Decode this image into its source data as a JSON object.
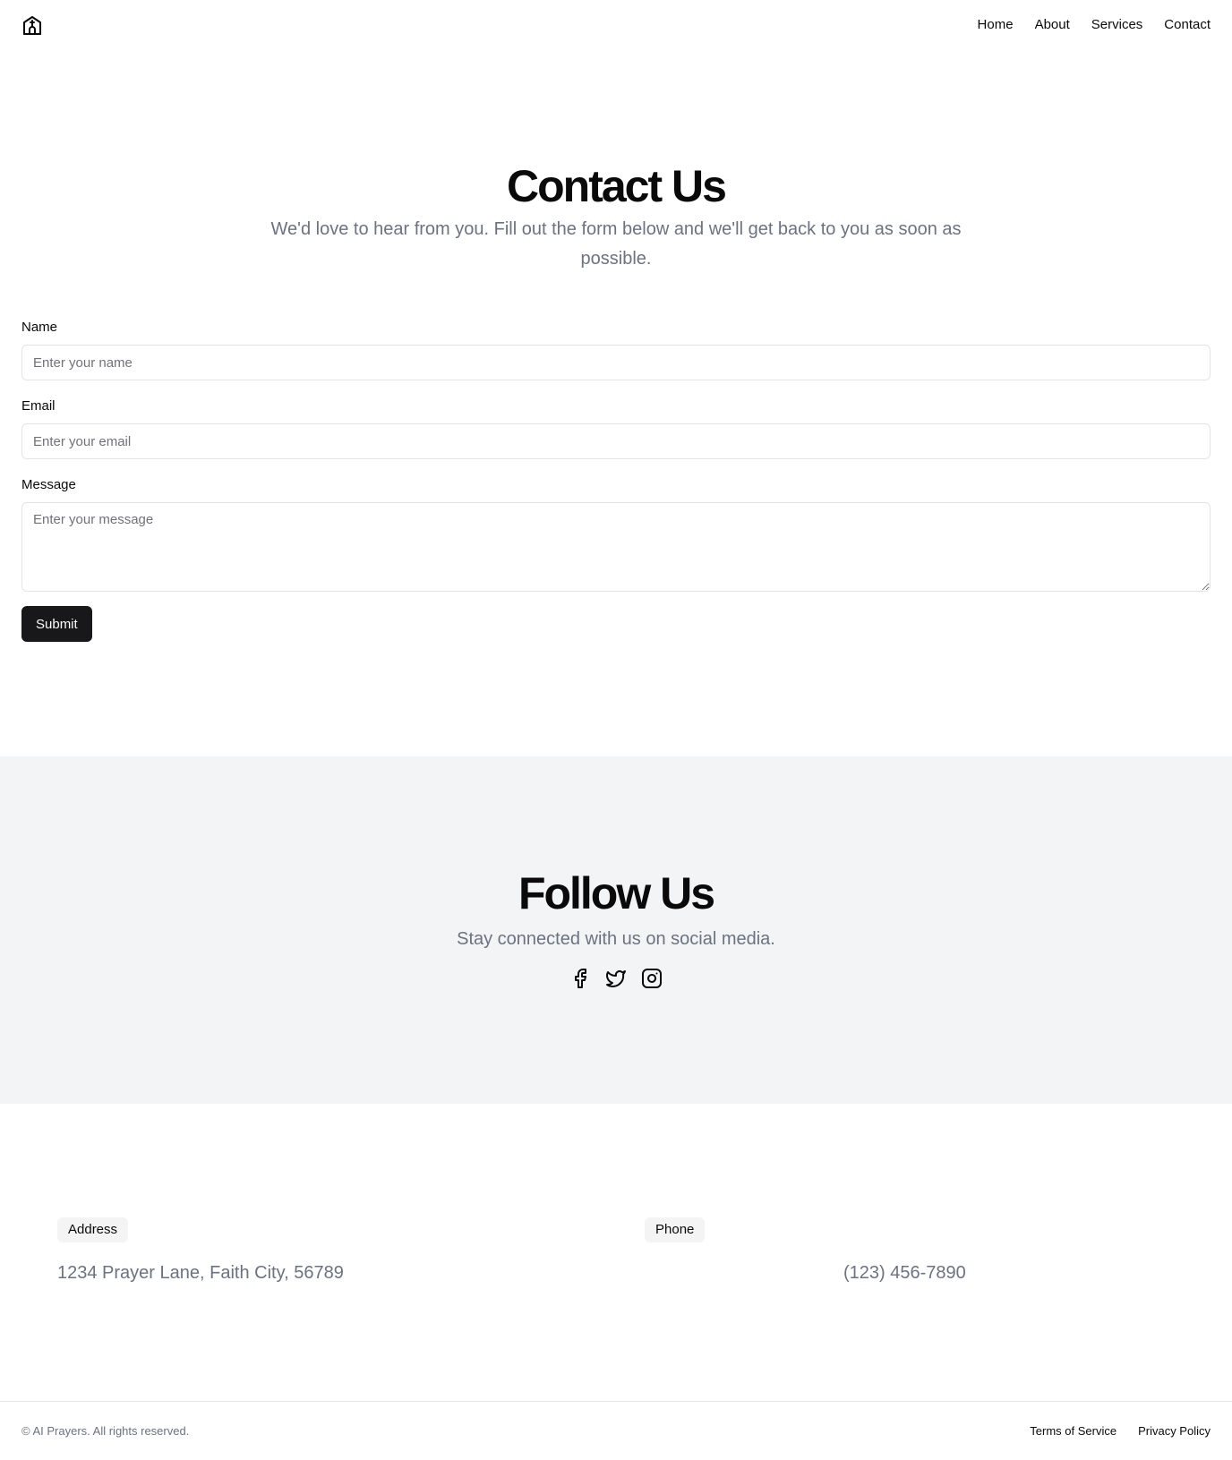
{
  "header": {
    "logo_icon": "church-icon",
    "nav": [
      {
        "label": "Home"
      },
      {
        "label": "About"
      },
      {
        "label": "Services"
      },
      {
        "label": "Contact"
      }
    ]
  },
  "contact": {
    "title": "Contact Us",
    "subtitle": "We'd love to hear from you. Fill out the form below and we'll get back to you as soon as possible.",
    "name": {
      "label": "Name",
      "placeholder": "Enter your name",
      "value": ""
    },
    "email": {
      "label": "Email",
      "placeholder": "Enter your email",
      "value": ""
    },
    "message": {
      "label": "Message",
      "placeholder": "Enter your message",
      "value": ""
    },
    "submit_label": "Submit"
  },
  "follow": {
    "title": "Follow Us",
    "subtitle": "Stay connected with us on social media.",
    "icons": [
      "facebook-icon",
      "twitter-icon",
      "instagram-icon"
    ]
  },
  "info": {
    "address_label": "Address",
    "address_value": "1234 Prayer Lane, Faith City, 56789",
    "phone_label": "Phone",
    "phone_value": "(123) 456-7890"
  },
  "footer": {
    "copyright": "© AI Prayers. All rights reserved.",
    "links": [
      {
        "label": "Terms of Service"
      },
      {
        "label": "Privacy Policy"
      }
    ]
  },
  "colors": {
    "text": "#0a0a0a",
    "muted": "#6b7280",
    "button_bg": "#18181b",
    "section_bg": "#f3f4f6",
    "badge_bg": "#f4f4f5",
    "border": "#e4e4e7"
  }
}
